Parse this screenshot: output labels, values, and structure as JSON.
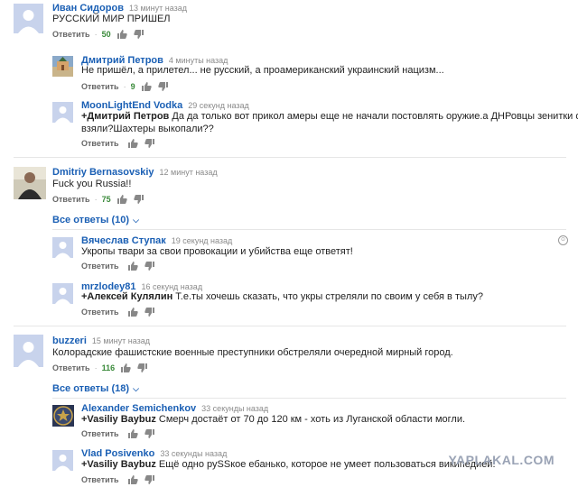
{
  "comments": [
    {
      "author": "Иван Сидоров",
      "time": "13 минут назад",
      "text": "РУССКИЙ МИР ПРИШЕЛ",
      "reply": "Ответить",
      "likes": "50"
    },
    {
      "author": "Дмитрий Петров",
      "time": "4 минуты назад",
      "text": "Не пришёл, а прилетел... не русский, а проамериканский украинский нацизм...",
      "reply": "Ответить",
      "likes": "9"
    },
    {
      "author": "MoonLightEnd Vodka",
      "time": "29 секунд назад",
      "mention": "+Дмитрий Петров",
      "text": " Да да только вот прикол амеры еще не начали постовлять оружие.а ДНРовцы зенитки откуда",
      "text2": "взяли?Шахтеры выкопали??",
      "reply": "Ответить"
    },
    {
      "author": "Dmitriy Bernasovskiy",
      "time": "12 минут назад",
      "text": "Fuck you Russia!!",
      "reply": "Ответить",
      "likes": "75"
    },
    {
      "author": "Вячеслав Ступак",
      "time": "19 секунд назад",
      "text": "Укропы твари за свои провокации и убийства еще ответят!",
      "reply": "Ответить"
    },
    {
      "author": "mrzlodey81",
      "time": "16 секунд назад",
      "mention": "+Алексей Кулялин",
      "text": " Т.е.ты хочешь сказать, что укры стреляли по своим у себя в тылу?",
      "reply": "Ответить"
    },
    {
      "author": "buzzeri",
      "time": "15 минут назад",
      "text": "Колорадские фашистские военные преступники обстреляли очередной мирный город.",
      "reply": "Ответить",
      "likes": "116"
    },
    {
      "author": "Alexander Semichenkov",
      "time": "33 секунды назад",
      "mention": "+Vasiliy Baybuz",
      "text": " Смерч достаёт от 70 до 120 км - хоть из Луганской области могли.",
      "reply": "Ответить"
    },
    {
      "author": "Vlad Posivenko",
      "time": "33 секунды назад",
      "mention": "+Vasiliy Baybuz",
      "text": " Ещё одно руSSкое ебанько, которое не умеет пользоваться википедией.",
      "reply": "Ответить"
    }
  ],
  "all_replies": [
    {
      "label": "Все ответы (10)"
    },
    {
      "label": "Все ответы (18)"
    }
  ],
  "watermark": "YAPLAKAL.COM",
  "colors": {
    "link": "#1a5fb4",
    "avatar_default": "#c8d3ec",
    "likes": "#3a8a3a"
  }
}
